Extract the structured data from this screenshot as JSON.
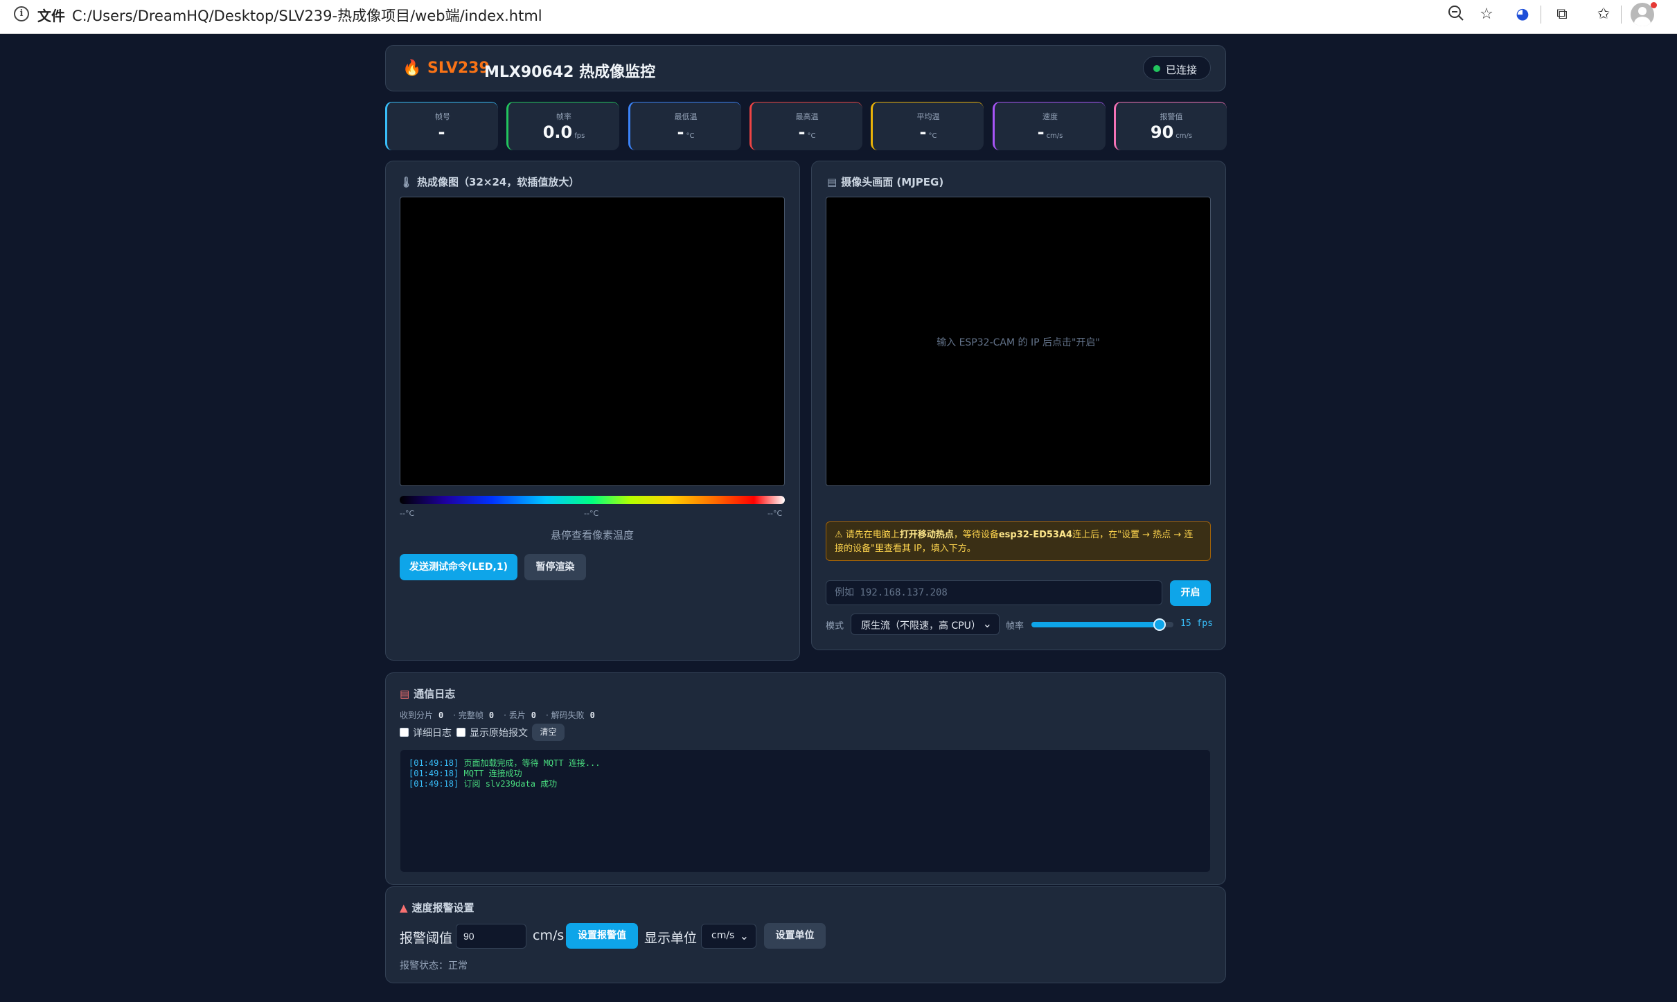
{
  "browser": {
    "file_label": "文件",
    "url": "C:/Users/DreamHQ/Desktop/SLV239-热成像项目/web端/index.html"
  },
  "header": {
    "brand": "SLV239",
    "title": "MLX90642 热成像监控",
    "status": "已连接",
    "status_color": "#22c55e"
  },
  "stats": [
    {
      "label": "帧号",
      "value": "-",
      "unit": "",
      "color": "#38bdf8"
    },
    {
      "label": "帧率",
      "value": "0.0",
      "unit": "fps",
      "color": "#22c55e"
    },
    {
      "label": "最低温",
      "value": "-",
      "unit": "°C",
      "color": "#3b82f6"
    },
    {
      "label": "最高温",
      "value": "-",
      "unit": "°C",
      "color": "#ef4444"
    },
    {
      "label": "平均温",
      "value": "-",
      "unit": "°C",
      "color": "#eab308"
    },
    {
      "label": "速度",
      "value": "-",
      "unit": "cm/s",
      "color": "#a855f7"
    },
    {
      "label": "报警值",
      "value": "90",
      "unit": "cm/s",
      "color": "#f472b6"
    }
  ],
  "thermal": {
    "title": "热成像图（32×24，软插值放大）",
    "cb_min": "--°C",
    "cb_mid": "--°C",
    "cb_max": "--°C",
    "hover_hint": "悬停查看像素温度",
    "send_btn": "发送测试命令(LED,1)",
    "pause_btn": "暂停渲染"
  },
  "camera": {
    "title": "摄像头画面 (MJPEG)",
    "hint": "输入 ESP32-CAM 的 IP 后点击\"开启\"",
    "warn_prefix": "请先在电脑上",
    "warn_bold1": "打开移动热点",
    "warn_mid": "，等待设备",
    "warn_bold2": "esp32-ED53A4",
    "warn_suffix": "连上后，在\"设置 → 热点 → 连接的设备\"里查看其 IP，填入下方。",
    "ip_placeholder": "例如 192.168.137.208",
    "open_btn": "开启",
    "mode_label": "模式",
    "mode_value": "原生流（不限速，高 CPU）",
    "fps_label": "帧率",
    "fps_value": "15 fps",
    "fps_level": 0.9
  },
  "log": {
    "title": "通信日志",
    "counters": [
      {
        "label": "收到分片",
        "value": "0"
      },
      {
        "label": "· 完整帧",
        "value": "0"
      },
      {
        "label": "· 丢片",
        "value": "0"
      },
      {
        "label": "· 解码失败",
        "value": "0"
      }
    ],
    "verbose_label": "详细日志",
    "raw_label": "显示原始报文",
    "clear_btn": "清空",
    "lines": [
      {
        "time": "[01:49:18]",
        "msg": "页面加载完成，等待 MQTT 连接..."
      },
      {
        "time": "[01:49:18]",
        "msg": "MQTT 连接成功"
      },
      {
        "time": "[01:49:18]",
        "msg": "订阅 slv239data 成功"
      }
    ]
  },
  "alarm": {
    "title": "速度报警设置",
    "threshold_label": "报警阈值",
    "threshold_value": "90",
    "unit_text": "cm/s",
    "set_btn": "设置报警值",
    "display_unit_label": "显示单位",
    "unit_select": "cm/s",
    "set_unit_btn": "设置单位",
    "status": "报警状态：正常"
  }
}
